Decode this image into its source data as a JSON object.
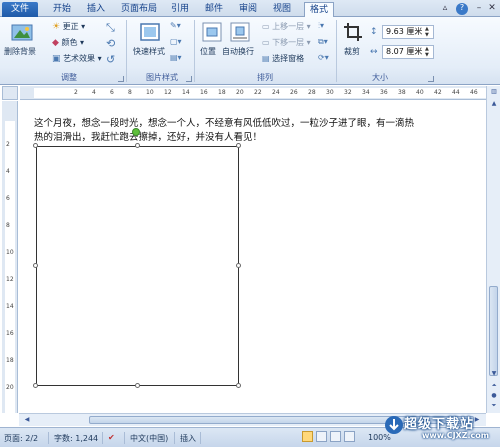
{
  "tabs": [
    {
      "label": "文件"
    },
    {
      "label": "开始"
    },
    {
      "label": "插入"
    },
    {
      "label": "页面布局"
    },
    {
      "label": "引用"
    },
    {
      "label": "邮件"
    },
    {
      "label": "审阅"
    },
    {
      "label": "视图"
    },
    {
      "label": "格式"
    }
  ],
  "active_tab": "格式",
  "ribbon": {
    "adjust": {
      "remove_bg": "删除背景",
      "corrections": "更正",
      "color": "颜色",
      "artistic": "艺术效果",
      "label": "调整"
    },
    "picstyles": {
      "quick_styles": "快速样式",
      "label": "图片样式"
    },
    "arrange": {
      "position": "位置",
      "wrap": "自动换行",
      "bring_forward": "上移一层",
      "send_backward": "下移一层",
      "selection_pane": "选择窗格",
      "label": "排列"
    },
    "size": {
      "crop": "裁剪",
      "height": "9.63 厘米",
      "width": "8.07 厘米",
      "label": "大小"
    }
  },
  "ruler": {
    "h_numbers": [
      "2",
      "4",
      "6",
      "8",
      "10",
      "12",
      "14",
      "16",
      "18",
      "20",
      "22",
      "24",
      "26",
      "28",
      "30",
      "32",
      "34",
      "36",
      "38",
      "40",
      "42",
      "44",
      "46",
      "48"
    ],
    "v_numbers": [
      "2",
      "4",
      "6",
      "8",
      "10",
      "12",
      "14",
      "16",
      "18",
      "20"
    ]
  },
  "document": {
    "line1": "这个月夜，想念一段时光，想念一个人，不经意有风低低吹过，一粒沙子进了眼，有一滴热",
    "line2": "热的泪滑出，我赶忙跑去擦掉，还好，并没有人看见！"
  },
  "status": {
    "page": "页面: 2/2",
    "words": "字数: 1,244",
    "language": "中文(中国)",
    "mode": "插入",
    "zoom": "100%"
  },
  "watermark": {
    "brand": "超级下载站",
    "url": "www.CJXZ.com"
  },
  "colors": {
    "file_tab": "#2a6ab8",
    "ribbon_bg": "#e4edf8",
    "text": "#1e395b"
  }
}
